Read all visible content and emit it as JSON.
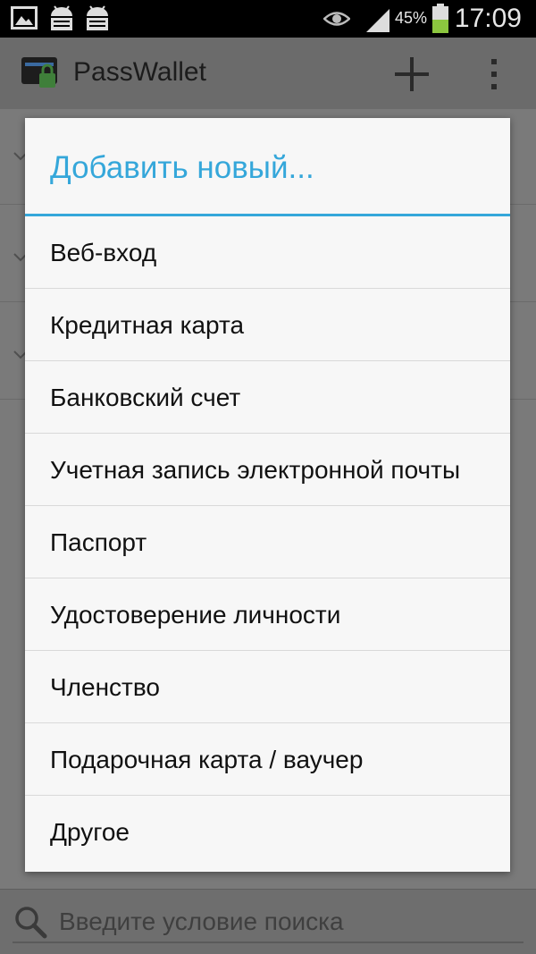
{
  "status_bar": {
    "battery_percent": "45%",
    "time": "17:09",
    "icons": [
      "image-icon",
      "android-debug-icon",
      "android-debug-icon",
      "eye-icon",
      "signal-icon",
      "battery-icon"
    ]
  },
  "app_bar": {
    "title": "PassWallet",
    "icons": [
      "wallet-lock-icon",
      "add-icon",
      "overflow-menu-icon"
    ]
  },
  "dialog": {
    "title": "Добавить новый...",
    "items": [
      {
        "label": "Веб-вход"
      },
      {
        "label": "Кредитная карта"
      },
      {
        "label": "Банковский счет"
      },
      {
        "label": "Учетная запись электронной почты"
      },
      {
        "label": "Паспорт"
      },
      {
        "label": "Удостоверение личности"
      },
      {
        "label": "Членство"
      },
      {
        "label": "Подарочная карта / ваучер"
      },
      {
        "label": "Другое"
      }
    ]
  },
  "search": {
    "placeholder": "Введите условие поиска",
    "value": ""
  },
  "colors": {
    "accent": "#35a7da",
    "dialog_bg": "#f7f7f7",
    "scrim": "#7a7a7a"
  }
}
